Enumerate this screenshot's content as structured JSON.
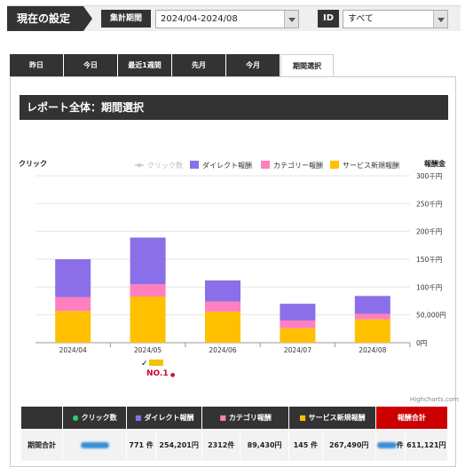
{
  "settings": {
    "current_label": "現在の設定",
    "period_label": "集計期間",
    "period_value": "2024/04-2024/08",
    "id_label": "ID",
    "id_value": "すべて"
  },
  "tabs": [
    "昨日",
    "今日",
    "最近1週間",
    "先月",
    "今月",
    "期間選択"
  ],
  "section_title": "レポート全体：期間選択",
  "chart_data": {
    "type": "bar",
    "stacked": true,
    "categories": [
      "2024/04",
      "2024/05",
      "2024/06",
      "2024/07",
      "2024/08"
    ],
    "left_axis_label": "クリック",
    "right_axis_label": "報酬金",
    "right_axis_ticks": [
      "300千円",
      "250千円",
      "200千円",
      "150千円",
      "100千円",
      "50,000円",
      "0円"
    ],
    "ylim": [
      0,
      300000
    ],
    "legend_position": "top-right",
    "series": [
      {
        "name": "クリック数",
        "type": "line",
        "color": "#cccccc",
        "disabled": true,
        "values": []
      },
      {
        "name": "ダイレクト報酬",
        "color": "#8b6fe8",
        "values": [
          68000,
          84000,
          38000,
          30000,
          32000
        ]
      },
      {
        "name": "カテゴリー報酬",
        "color": "#ff7fbf",
        "values": [
          25000,
          22000,
          18000,
          14000,
          10000
        ]
      },
      {
        "name": "サービス新規報酬",
        "color": "#ffc000",
        "values": [
          57000,
          83000,
          56000,
          26000,
          42000
        ]
      }
    ]
  },
  "logo_text": "NO.1",
  "credit": "Highcharts.com",
  "table": {
    "headers": [
      "",
      "クリック数",
      "ダイレクト報酬",
      "カテゴリ報酬",
      "サービス新規報酬",
      "報酬合計"
    ],
    "header_colors": [
      "",
      "#2ecc71",
      "#8b6fe8",
      "#ff7fbf",
      "#ffc000",
      ""
    ],
    "row": {
      "label": "期間合計",
      "direct_count": "771 件",
      "direct_amount": "254,201円",
      "category_count": "2312件",
      "category_amount": "89,430円",
      "service_count": "145 件",
      "service_amount": "267,490円",
      "total_unit": "件",
      "total_amount": "611,121円"
    }
  }
}
